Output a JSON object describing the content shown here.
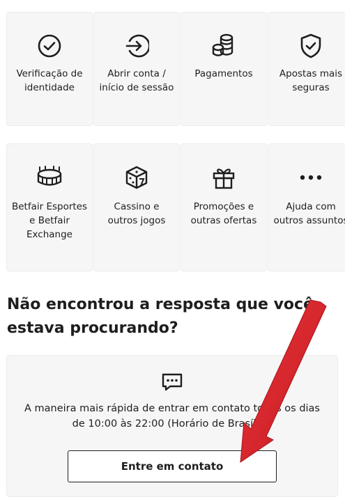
{
  "categories": [
    {
      "label": "Verificação de identidade",
      "icon": "check-circle-icon"
    },
    {
      "label": "Abrir conta / início de sessão",
      "icon": "login-arrow-icon"
    },
    {
      "label": "Pagamentos",
      "icon": "coins-icon"
    },
    {
      "label": "Apostas mais seguras",
      "icon": "shield-check-icon"
    },
    {
      "label": "Betfair Esportes e Betfair Exchange",
      "icon": "stadium-icon"
    },
    {
      "label": "Cassino e outros jogos",
      "icon": "dice-icon"
    },
    {
      "label": "Promoções e outras ofertas",
      "icon": "gift-icon"
    },
    {
      "label": "Ajuda com outros assuntos",
      "icon": "more-dots-icon"
    }
  ],
  "contact": {
    "heading": "Não encontrou a resposta que você estava procurando?",
    "message": "A maneira mais rápida de entrar em contato todos os dias de 10:00 às 22:00 (Horário de Brasília).",
    "button_label": "Entre em contato",
    "icon": "chat-bubble-icon"
  },
  "colors": {
    "tile_bg": "#f6f6f6",
    "text": "#1e1e1e",
    "annotation_arrow": "#d9232a"
  }
}
